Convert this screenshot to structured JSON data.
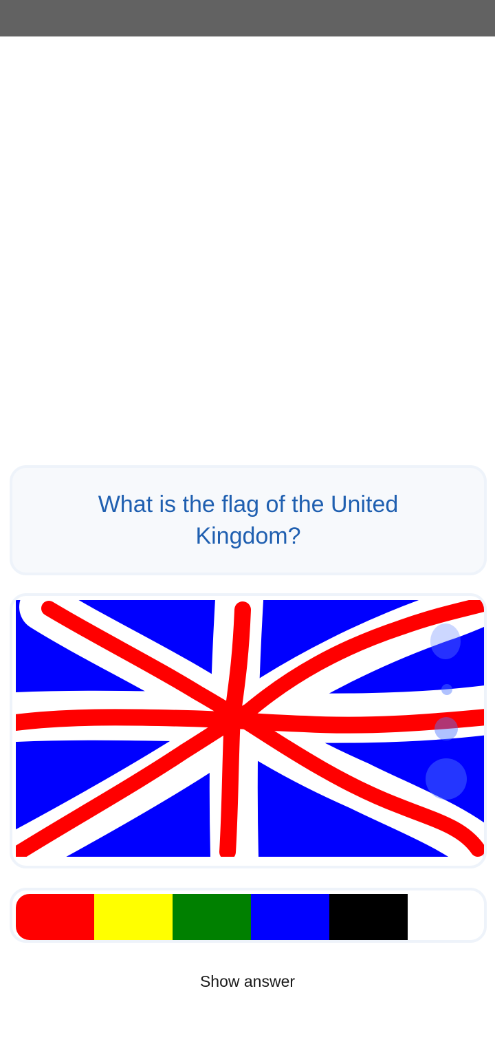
{
  "question": {
    "text": "What is the flag of the United Kingdom?"
  },
  "canvas": {
    "background_color": "#0000ff",
    "strokes": [
      {
        "color": "#ffffff",
        "role": "white-outline"
      },
      {
        "color": "#ff0000",
        "role": "red-cross"
      }
    ],
    "tools": [
      {
        "name": "eraser-icon"
      },
      {
        "name": "brush-size-small"
      },
      {
        "name": "brush-size-medium"
      },
      {
        "name": "brush-size-large"
      }
    ]
  },
  "palette": {
    "colors": [
      "#ff0000",
      "#ffff00",
      "#008000",
      "#0000ff",
      "#000000",
      "#ffffff"
    ]
  },
  "actions": {
    "show_answer_label": "Show answer"
  }
}
